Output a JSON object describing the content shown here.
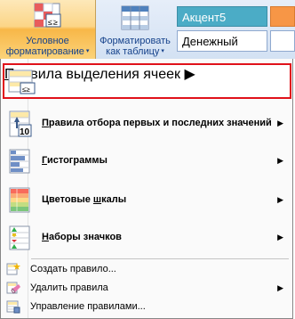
{
  "ribbon": {
    "conditional_formatting": {
      "line1": "Условное",
      "line2": "форматирование"
    },
    "format_as_table": {
      "line1": "Форматировать",
      "line2": "как таблицу"
    },
    "styles": {
      "accent": "Акцент5",
      "money": "Денежный"
    }
  },
  "menu": {
    "items": [
      {
        "label": "Правила выделения ячеек",
        "underline_char": "П",
        "rest": "равила выделения ячеек",
        "icon": "highlight-cells-rules-icon"
      },
      {
        "label": "Правила отбора первых и последних значений",
        "underline_char": "П",
        "rest": "равила отбора первых и последних значений",
        "icon": "top-bottom-rules-icon"
      },
      {
        "label": "Гистограммы",
        "underline_char": "Г",
        "rest": "истограммы",
        "icon": "data-bars-icon"
      },
      {
        "label": "Цветовые шкалы",
        "pre": "Цветовые ",
        "underline_char": "ш",
        "rest": "калы",
        "icon": "color-scales-icon"
      },
      {
        "label": "Наборы значков",
        "underline_char": "Н",
        "rest": "аборы значков",
        "icon": "icon-sets-icon"
      }
    ],
    "small_items": [
      {
        "label": "Создать правило...",
        "icon": "new-rule-icon"
      },
      {
        "label": "Удалить правила",
        "icon": "clear-rules-icon"
      },
      {
        "label": "Управление правилами...",
        "icon": "manage-rules-icon"
      }
    ]
  },
  "colors": {
    "highlight_border": "#e0121a",
    "accent5": "#4bacc6",
    "ribbon_active": "#f8b748"
  }
}
